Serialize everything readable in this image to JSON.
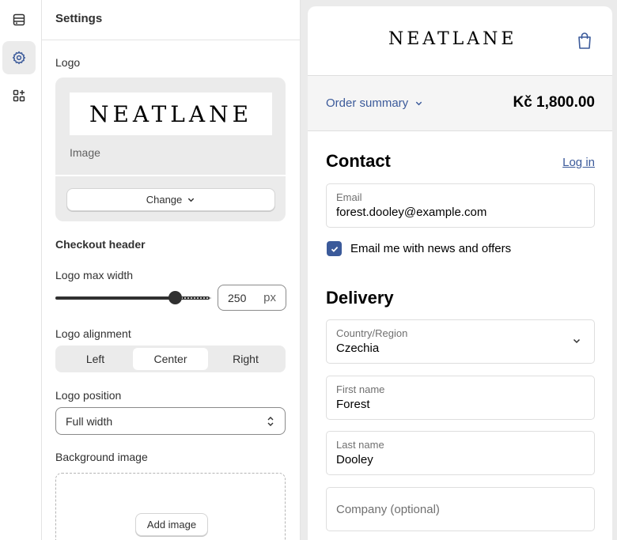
{
  "panel": {
    "title": "Settings",
    "logo_label": "Logo",
    "logo_preview_text": "NEATLANE",
    "logo_image_label": "Image",
    "change_button": "Change",
    "checkout_header_title": "Checkout header",
    "logo_max_width_label": "Logo max width",
    "logo_max_width_value": "250",
    "logo_max_width_unit": "px",
    "logo_max_width_fraction": 0.77,
    "logo_alignment_label": "Logo alignment",
    "alignment_options": [
      "Left",
      "Center",
      "Right"
    ],
    "alignment_selected": "Center",
    "logo_position_label": "Logo position",
    "logo_position_value": "Full width",
    "background_image_label": "Background image",
    "add_image_button": "Add image"
  },
  "preview": {
    "logo_text": "NEATLANE",
    "order_summary_label": "Order summary",
    "order_total": "Kč 1,800.00",
    "contact_heading": "Contact",
    "login_link": "Log in",
    "email_label": "Email",
    "email_value": "forest.dooley@example.com",
    "newsletter_label": "Email me with news and offers",
    "newsletter_checked": true,
    "delivery_heading": "Delivery",
    "country_label": "Country/Region",
    "country_value": "Czechia",
    "first_name_label": "First name",
    "first_name_value": "Forest",
    "last_name_label": "Last name",
    "last_name_value": "Dooley",
    "company_placeholder": "Company (optional)"
  },
  "icons": {
    "rail": [
      "sections-icon",
      "settings-icon",
      "apps-icon"
    ],
    "cart": "shopping-bag-icon"
  },
  "colors": {
    "link": "#3b5a9a",
    "checkbox": "#3b5a9a",
    "rail_active": "#ebebeb"
  }
}
